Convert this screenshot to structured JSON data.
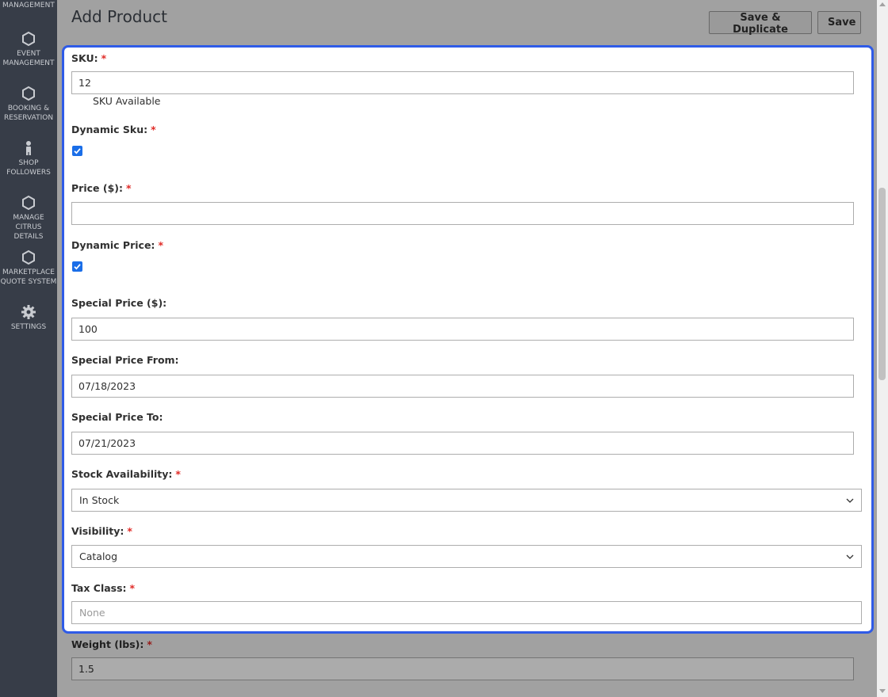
{
  "sidebar": {
    "top_partial_label": "MANAGEMENT",
    "items": [
      {
        "icon": "hexagon-icon",
        "label_line1": "EVENT",
        "label_line2": "MANAGEMENT"
      },
      {
        "icon": "hexagon-icon",
        "label_line1": "BOOKING &",
        "label_line2": "RESERVATION"
      },
      {
        "icon": "person-icon",
        "label_line1": "SHOP",
        "label_line2": "FOLLOWERS"
      },
      {
        "icon": "hexagon-icon",
        "label_line1": "MANAGE",
        "label_line2": "CITRUS DETAILS"
      },
      {
        "icon": "hexagon-icon",
        "label_line1": "MARKETPLACE",
        "label_line2": "QUOTE SYSTEM"
      },
      {
        "icon": "gear-icon",
        "label_line1": "SETTINGS",
        "label_line2": ""
      }
    ]
  },
  "header": {
    "title": "Add Product",
    "save_duplicate_label": "Save & Duplicate",
    "save_label": "Save"
  },
  "form": {
    "sku": {
      "label": "SKU:",
      "value": "12",
      "hint": "SKU Available",
      "required": "*"
    },
    "dynamic_sku": {
      "label": "Dynamic Sku:",
      "checked": true,
      "required": "*"
    },
    "price": {
      "label": "Price ($):",
      "value": "",
      "required": "*"
    },
    "dynamic_price": {
      "label": "Dynamic Price:",
      "checked": true,
      "required": "*"
    },
    "special_price": {
      "label": "Special Price ($):",
      "value": "100"
    },
    "special_price_from": {
      "label": "Special Price From:",
      "value": "07/18/2023"
    },
    "special_price_to": {
      "label": "Special Price To:",
      "value": "07/21/2023"
    },
    "stock_availability": {
      "label": "Stock Availability:",
      "value": "In Stock",
      "required": "*"
    },
    "visibility": {
      "label": "Visibility:",
      "value": "Catalog",
      "required": "*"
    },
    "tax_class": {
      "label": "Tax Class:",
      "placeholder": "None",
      "required": "*"
    },
    "weight": {
      "label": "Weight (lbs):",
      "value": "1.5",
      "required": "*"
    }
  },
  "colors": {
    "highlight_border": "#2f5be7",
    "sidebar_bg": "#373d48",
    "required_star": "#e02b27",
    "checkbox": "#1a6ee8"
  }
}
